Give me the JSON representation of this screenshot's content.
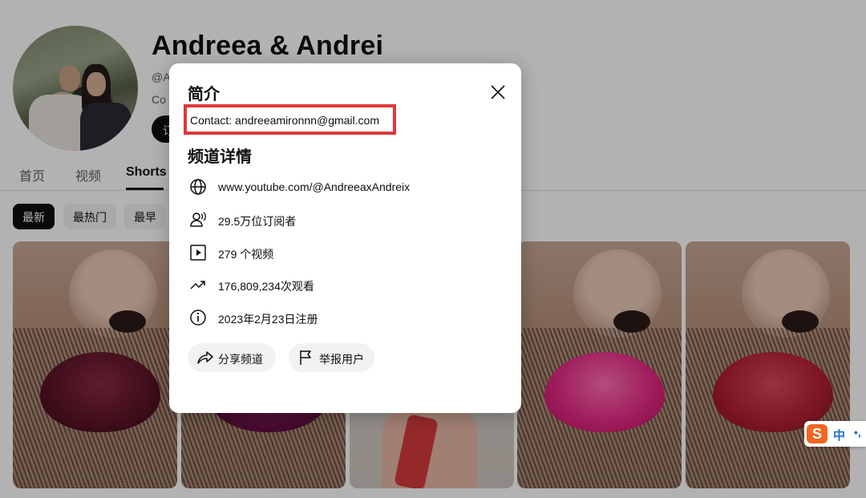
{
  "channel": {
    "name": "Andreea & Andrei",
    "handle_partial": "@A",
    "description_partial": "Co",
    "subscribe_partial": "订"
  },
  "tabs": [
    {
      "label": "首页",
      "active": false
    },
    {
      "label": "视频",
      "active": false
    },
    {
      "label": "Shorts",
      "active": true
    }
  ],
  "chips": [
    {
      "label": "最新",
      "active": true
    },
    {
      "label": "最热门",
      "active": false
    },
    {
      "label": "最早",
      "active": false
    }
  ],
  "modal": {
    "title": "简介",
    "contact": "Contact: andreeamironnn@gmail.com",
    "details_title": "频道详情",
    "details": [
      {
        "icon": "globe-icon",
        "text": "www.youtube.com/@AndreeaxAndreix"
      },
      {
        "icon": "subscribers-icon",
        "text": "29.5万位订阅者"
      },
      {
        "icon": "video-icon",
        "text": "279 个视频"
      },
      {
        "icon": "trending-icon",
        "text": "176,809,234次观看"
      },
      {
        "icon": "info-icon",
        "text": "2023年2月23日注册"
      }
    ],
    "share_label": "分享频道",
    "report_label": "举报用户"
  },
  "ime": {
    "logo": "S",
    "mode": "中",
    "extra": "•,"
  },
  "colors": {
    "highlight_box": "#e0393b",
    "overlay": "rgba(0,0,0,0.30)",
    "ime_logo": "#f26522"
  }
}
